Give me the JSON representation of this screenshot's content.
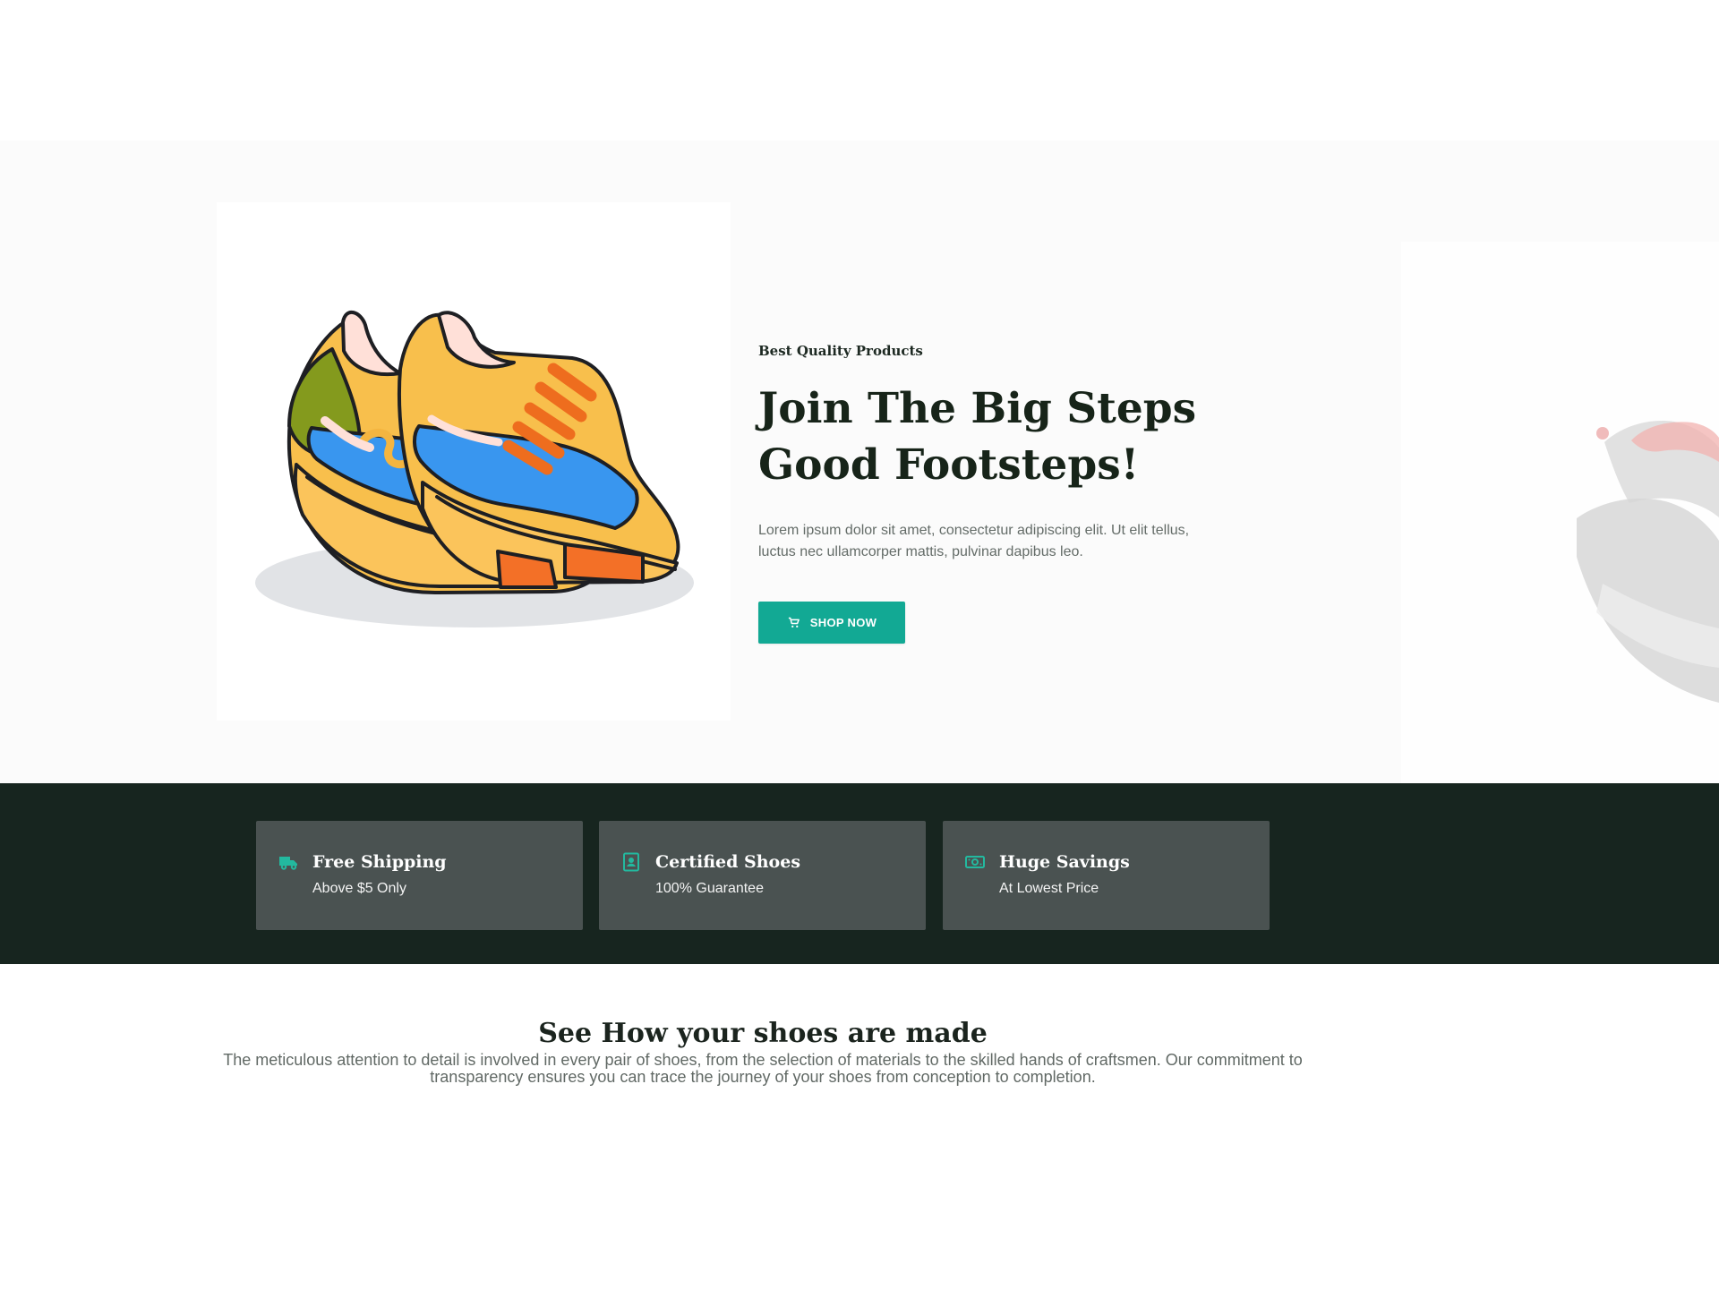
{
  "hero": {
    "eyebrow": "Best Quality Products",
    "title": "Join The Big Steps Good Footsteps!",
    "description": "Lorem ipsum dolor sit amet, consectetur adipiscing elit. Ut elit tellus, luctus nec ullamcorper mattis, pulvinar dapibus leo.",
    "button_label": "SHOP NOW",
    "button_icon": "cart-icon",
    "image_semantic": "colorful-sneakers-illustration",
    "side_image_semantic": "faded-gray-sneaker-image"
  },
  "features": [
    {
      "icon": "truck-icon",
      "title": "Free Shipping",
      "subtitle": "Above $5 Only"
    },
    {
      "icon": "certificate-icon",
      "title": "Certified Shoes",
      "subtitle": "100% Guarantee"
    },
    {
      "icon": "money-icon",
      "title": "Huge Savings",
      "subtitle": "At Lowest Price"
    }
  ],
  "made_section": {
    "title": "See How your shoes are made",
    "description": "The meticulous attention to detail is involved in every pair of shoes, from the selection of materials to the skilled hands of craftsmen. Our commitment to transparency ensures you can trace the journey of your shoes from conception to completion."
  },
  "colors": {
    "accent": "#12a994",
    "dark_band": "#17251f",
    "feature_card": "#4a5251",
    "page_background": "#fbfbfb"
  }
}
